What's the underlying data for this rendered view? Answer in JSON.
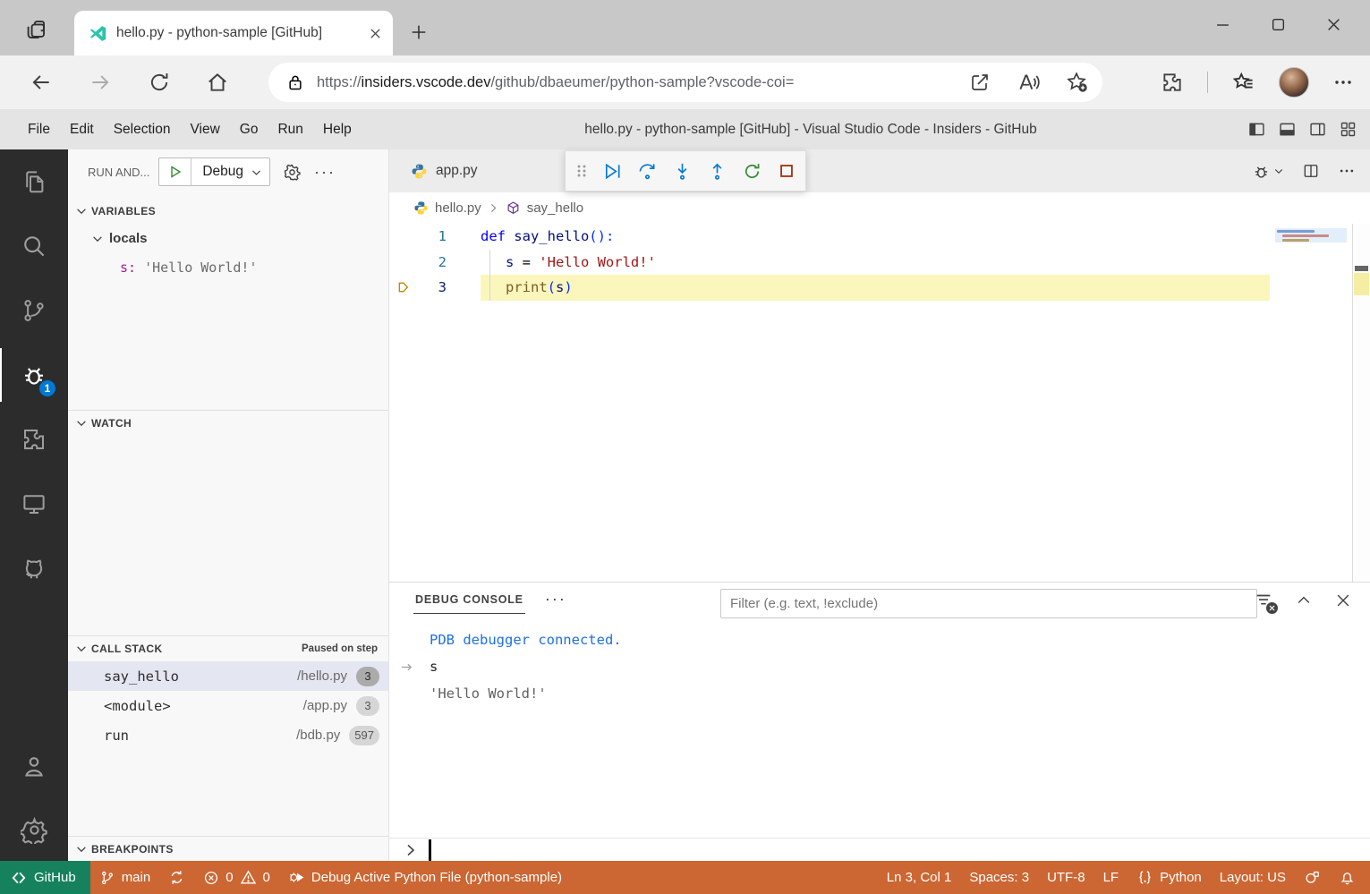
{
  "browser": {
    "tab_title": "hello.py - python-sample [GitHub]",
    "url_scheme": "https://",
    "url_host": "insiders.vscode.dev",
    "url_path": "/github/dbaeumer/python-sample?vscode-coi="
  },
  "titlebar": {
    "menus": [
      "File",
      "Edit",
      "Selection",
      "View",
      "Go",
      "Run",
      "Help"
    ],
    "window_title": "hello.py - python-sample [GitHub] - Visual Studio Code - Insiders - GitHub"
  },
  "activity_bar": {
    "debug_badge": "1"
  },
  "sidebar": {
    "panel_title": "RUN AND...",
    "debug_config": "Debug",
    "variables": {
      "title": "VARIABLES",
      "scope": "locals",
      "var_name": "s:",
      "var_value": "'Hello World!'"
    },
    "watch": {
      "title": "WATCH"
    },
    "call_stack": {
      "title": "CALL STACK",
      "status": "Paused on step",
      "frames": [
        {
          "name": "say_hello",
          "file": "/hello.py",
          "line": "3"
        },
        {
          "name": "<module>",
          "file": "/app.py",
          "line": "3"
        },
        {
          "name": "run",
          "file": "/bdb.py",
          "line": "597"
        }
      ]
    },
    "breakpoints": {
      "title": "BREAKPOINTS"
    }
  },
  "editor": {
    "tab_label": "app.py",
    "breadcrumb_file": "hello.py",
    "breadcrumb_symbol": "say_hello",
    "lines": {
      "n1": "1",
      "n2": "2",
      "n3": "3",
      "l1_kw": "def",
      "l1_name": "say_hello",
      "l1_punct": "():",
      "l2_name": "s",
      "l2_op": "=",
      "l2_str": "'Hello World!'",
      "l3_fn": "print",
      "l3_p1": "(",
      "l3_arg": "s",
      "l3_p2": ")"
    }
  },
  "panel": {
    "tab_label": "DEBUG CONSOLE",
    "filter_placeholder": "Filter (e.g. text, !exclude)",
    "line_info": "PDB debugger connected.",
    "line_input": "s",
    "line_result": "'Hello World!'"
  },
  "statusbar": {
    "remote": "GitHub",
    "branch": "main",
    "errors": "0",
    "warnings": "0",
    "debug_status": "Debug Active Python File (python-sample)",
    "cursor": "Ln 3, Col 1",
    "indent": "Spaces: 3",
    "encoding": "UTF-8",
    "eol": "LF",
    "language": "Python",
    "layout": "Layout: US"
  },
  "colors": {
    "status_debug": "#CC6633",
    "remote_green": "#16825D",
    "badge_blue": "#0078D4",
    "line_highlight": "#FBF6BC",
    "keyword": "#0000FF",
    "string": "#A31515",
    "function": "#795E26",
    "console_info": "#1F6FEB"
  }
}
